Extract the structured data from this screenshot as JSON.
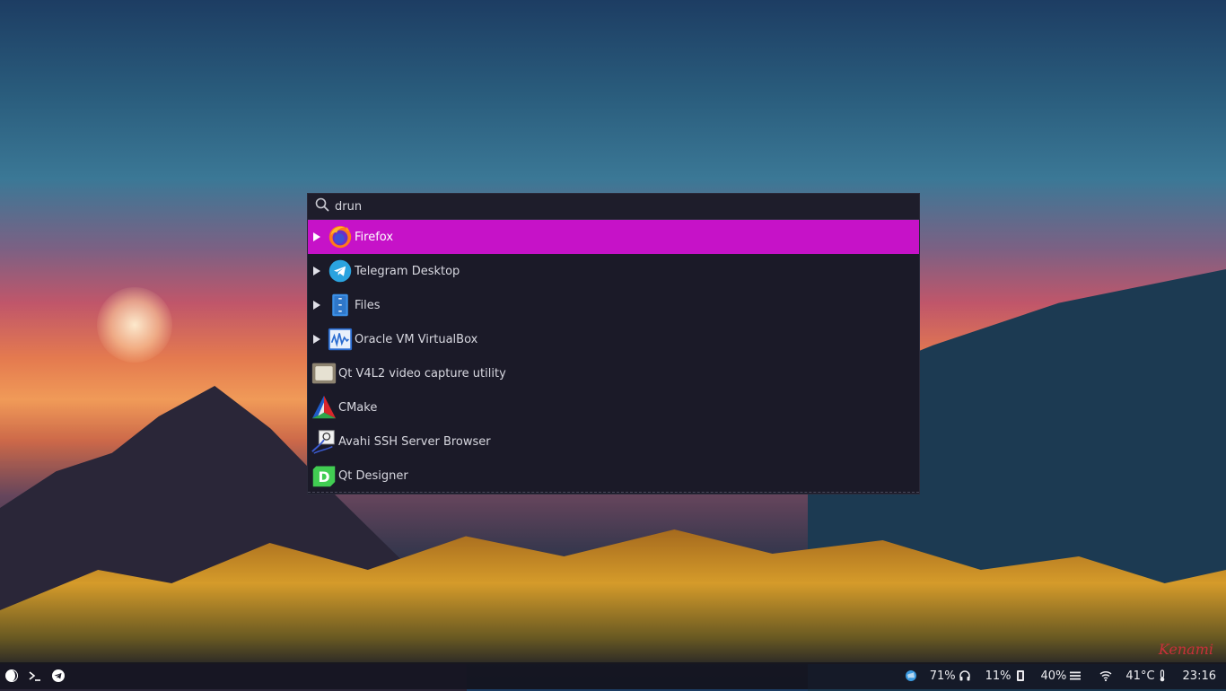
{
  "launcher": {
    "search": {
      "placeholder": "drun",
      "value": "drun"
    },
    "entries": [
      {
        "label": "Firefox",
        "icon": "firefox-icon",
        "selected": true,
        "has_submenu": true
      },
      {
        "label": "Telegram Desktop",
        "icon": "telegram-icon",
        "selected": false,
        "has_submenu": true
      },
      {
        "label": "Files",
        "icon": "files-icon",
        "selected": false,
        "has_submenu": true
      },
      {
        "label": "Oracle VM VirtualBox",
        "icon": "virtualbox-icon",
        "selected": false,
        "has_submenu": true
      },
      {
        "label": "Qt V4L2 video capture utility",
        "icon": "video-capture-icon",
        "selected": false,
        "has_submenu": false
      },
      {
        "label": "CMake",
        "icon": "cmake-icon",
        "selected": false,
        "has_submenu": false
      },
      {
        "label": "Avahi SSH Server Browser",
        "icon": "avahi-icon",
        "selected": false,
        "has_submenu": false
      },
      {
        "label": "Qt Designer",
        "icon": "qt-designer-icon",
        "selected": false,
        "has_submenu": false
      }
    ],
    "colors": {
      "selected_bg": "#c612c8",
      "bg": "#1b1a28",
      "text": "#d8d8e0"
    }
  },
  "taskbar": {
    "left_icons": [
      "app-menu-icon",
      "terminal-icon",
      "telegram-icon"
    ],
    "tray": {
      "volume": {
        "value": "71%",
        "icon": "headphones-icon"
      },
      "cpu": {
        "value": "11%",
        "icon": "chip-icon"
      },
      "memory": {
        "value": "40%",
        "icon": "menu-lines-icon"
      },
      "wifi": {
        "icon": "wifi-icon"
      },
      "temperature": {
        "value": "41°C",
        "icon": "thermometer-icon"
      },
      "clock": "23:16"
    }
  },
  "wallpaper": {
    "signature": "Kenami"
  }
}
